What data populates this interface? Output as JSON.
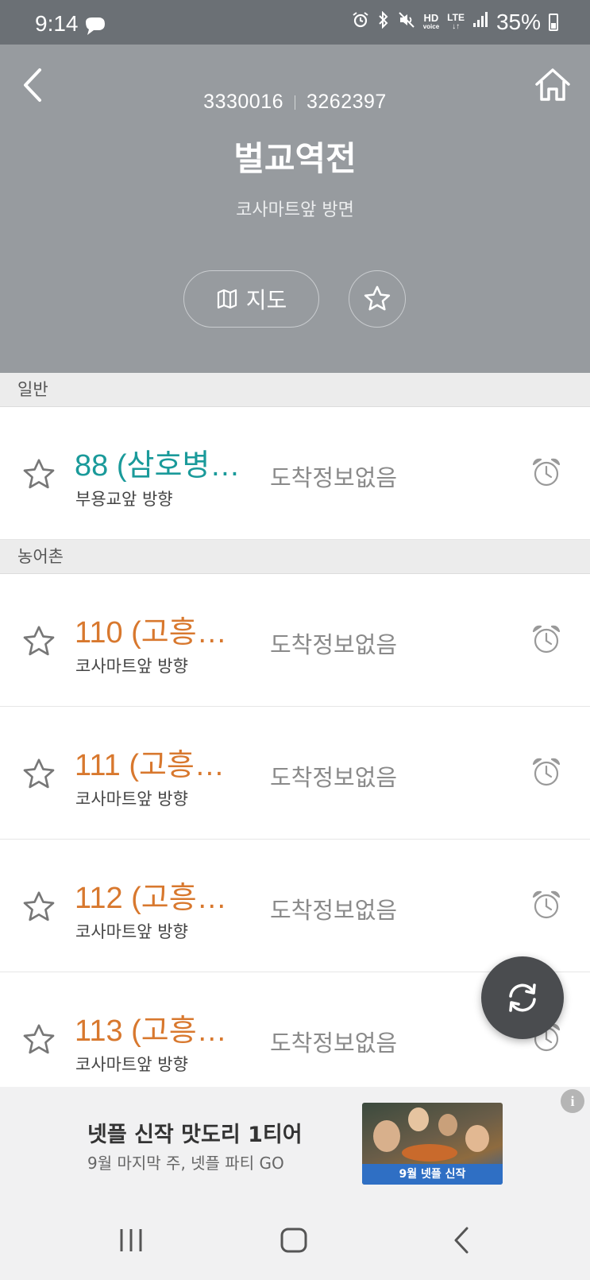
{
  "status_bar": {
    "time": "9:14",
    "hd_label": "HD",
    "voice_label": "voice",
    "lte_label": "LTE",
    "battery": "35%"
  },
  "header": {
    "stop_id_1": "3330016",
    "stop_id_2": "3262397",
    "stop_name": "벌교역전",
    "direction": "코사마트앞 방면",
    "map_label": "지도"
  },
  "sections": [
    {
      "label": "일반",
      "routes": [
        {
          "route": "88 (삼호병…",
          "direction": "부용교앞 방향",
          "arrival": "도착정보없음",
          "color": "#1a9a9a"
        }
      ]
    },
    {
      "label": "농어촌",
      "routes": [
        {
          "route": "110 (고흥…",
          "direction": "코사마트앞 방향",
          "arrival": "도착정보없음",
          "color": "#d8782e"
        },
        {
          "route": "111 (고흥…",
          "direction": "코사마트앞 방향",
          "arrival": "도착정보없음",
          "color": "#d8782e"
        },
        {
          "route": "112 (고흥…",
          "direction": "코사마트앞 방향",
          "arrival": "도착정보없음",
          "color": "#d8782e"
        },
        {
          "route": "113 (고흥…",
          "direction": "코사마트앞 방향",
          "arrival": "도착정보없음",
          "color": "#d8782e"
        }
      ]
    }
  ],
  "ad": {
    "title": "넷플 신작 맛도리 1티어",
    "subtitle": "9월 마지막 주, 넷플 파티 GO",
    "image_caption": "9월 넷플 신작",
    "info_icon": "i"
  },
  "icons": {
    "back": "chevron-left-icon",
    "home": "home-icon",
    "map": "map-icon",
    "favorite": "star-icon",
    "alarm": "alarm-clock-icon",
    "refresh": "refresh-icon"
  }
}
